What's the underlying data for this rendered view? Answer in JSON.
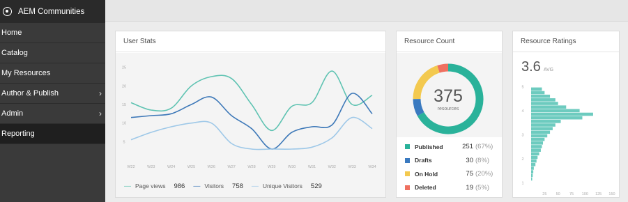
{
  "sidebar": {
    "brand": "AEM Communities",
    "items": [
      {
        "label": "Home",
        "chevron": false,
        "active": false
      },
      {
        "label": "Catalog",
        "chevron": false,
        "active": false
      },
      {
        "label": "My Resources",
        "chevron": false,
        "active": false
      },
      {
        "label": "Author & Publish",
        "chevron": true,
        "active": false
      },
      {
        "label": "Admin",
        "chevron": true,
        "active": false
      },
      {
        "label": "Reporting",
        "chevron": false,
        "active": true
      }
    ]
  },
  "user_stats": {
    "title": "User Stats",
    "legend": [
      {
        "label": "Page views",
        "value": "986",
        "color": "#5fc3b2"
      },
      {
        "label": "Visitors",
        "value": "758",
        "color": "#3d78b8"
      },
      {
        "label": "Unique Visitors",
        "value": "529",
        "color": "#9ec8e8"
      }
    ]
  },
  "resource_count": {
    "title": "Resource Count",
    "total": "375",
    "total_label": "resources",
    "items": [
      {
        "label": "Published",
        "count": "251",
        "pct": "(67%)",
        "color": "#2ab29a"
      },
      {
        "label": "Drafts",
        "count": "30",
        "pct": "(8%)",
        "color": "#3a7ac0"
      },
      {
        "label": "On Hold",
        "count": "75",
        "pct": "(20%)",
        "color": "#f3c94f"
      },
      {
        "label": "Deleted",
        "count": "19",
        "pct": "(5%)",
        "color": "#ef7060"
      }
    ]
  },
  "resource_ratings": {
    "title": "Resource Ratings",
    "avg": "3.6",
    "avg_label": "AVG"
  },
  "chart_data": [
    {
      "type": "line",
      "x": [
        "W22",
        "W23",
        "W24",
        "W25",
        "W26",
        "W27",
        "W28",
        "W29",
        "W30",
        "W31",
        "W32",
        "W33",
        "W34"
      ],
      "ylim": [
        0,
        27
      ],
      "yticks": [
        5,
        10,
        15,
        20,
        25
      ],
      "series": [
        {
          "name": "Page views",
          "color": "#5fc3b2",
          "values": [
            15.5,
            13.5,
            14,
            20,
            22.5,
            22,
            15,
            8,
            14.5,
            15.5,
            24,
            15,
            17.5
          ]
        },
        {
          "name": "Visitors",
          "color": "#3d78b8",
          "values": [
            11.5,
            12,
            12.5,
            15,
            17,
            12,
            8.5,
            3,
            7.5,
            9,
            9.5,
            18,
            12.5
          ]
        },
        {
          "name": "Unique Visitors",
          "color": "#9ec8e8",
          "values": [
            5.5,
            7.5,
            9,
            10,
            10,
            4.5,
            3,
            3,
            3,
            3.5,
            6,
            11.5,
            8.5
          ]
        }
      ]
    },
    {
      "type": "pie",
      "categories": [
        "Published",
        "Drafts",
        "On Hold",
        "Deleted"
      ],
      "values": [
        251,
        30,
        75,
        19
      ]
    },
    {
      "type": "bar",
      "orientation": "horizontal",
      "xlim": [
        0,
        150
      ],
      "xticks": [
        25,
        50,
        75,
        100,
        125,
        150
      ],
      "ylim": [
        1,
        5
      ],
      "yticks": [
        1,
        2,
        3,
        4,
        5
      ],
      "color": "#6dcbbf",
      "bin_centers": [
        4.9,
        4.75,
        4.6,
        4.45,
        4.3,
        4.15,
        4.0,
        3.85,
        3.7,
        3.55,
        3.4,
        3.25,
        3.1,
        2.95,
        2.8,
        2.65,
        2.5,
        2.35,
        2.2,
        2.05,
        1.9,
        1.75,
        1.6,
        1.45,
        1.3,
        1.15
      ],
      "values": [
        20,
        25,
        35,
        45,
        50,
        65,
        90,
        115,
        95,
        55,
        45,
        40,
        35,
        30,
        25,
        22,
        20,
        18,
        15,
        12,
        10,
        8,
        5,
        4,
        3,
        2
      ]
    }
  ]
}
